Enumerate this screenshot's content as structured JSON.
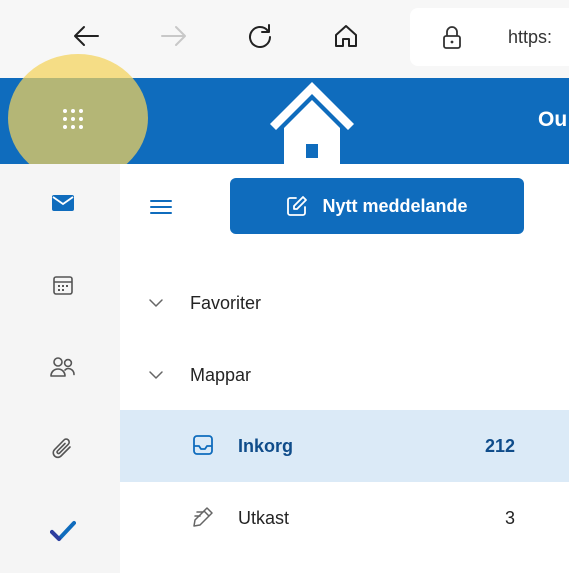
{
  "browser": {
    "url_text": "https:",
    "back_icon": "arrow-left-icon",
    "forward_icon": "arrow-right-icon",
    "refresh_icon": "refresh-icon",
    "home_icon": "home-icon",
    "lock_icon": "lock-icon"
  },
  "header": {
    "brand_text": "Ou",
    "accent_color": "#0f6cbd",
    "highlight_color": "#f4d25a"
  },
  "rail": {
    "items": [
      {
        "name": "mail",
        "icon": "mail-icon"
      },
      {
        "name": "calendar",
        "icon": "calendar-icon"
      },
      {
        "name": "people",
        "icon": "people-icon"
      },
      {
        "name": "files",
        "icon": "paperclip-icon"
      },
      {
        "name": "todo",
        "icon": "checkmark-icon"
      }
    ]
  },
  "folder_pane": {
    "new_message_label": "Nytt meddelande",
    "sections": [
      {
        "label": "Favoriter"
      },
      {
        "label": "Mappar"
      }
    ],
    "folders": [
      {
        "label": "Inkorg",
        "count": "212",
        "selected": true,
        "icon": "inbox-icon"
      },
      {
        "label": "Utkast",
        "count": "3",
        "selected": false,
        "icon": "draft-pencil-icon"
      }
    ]
  }
}
